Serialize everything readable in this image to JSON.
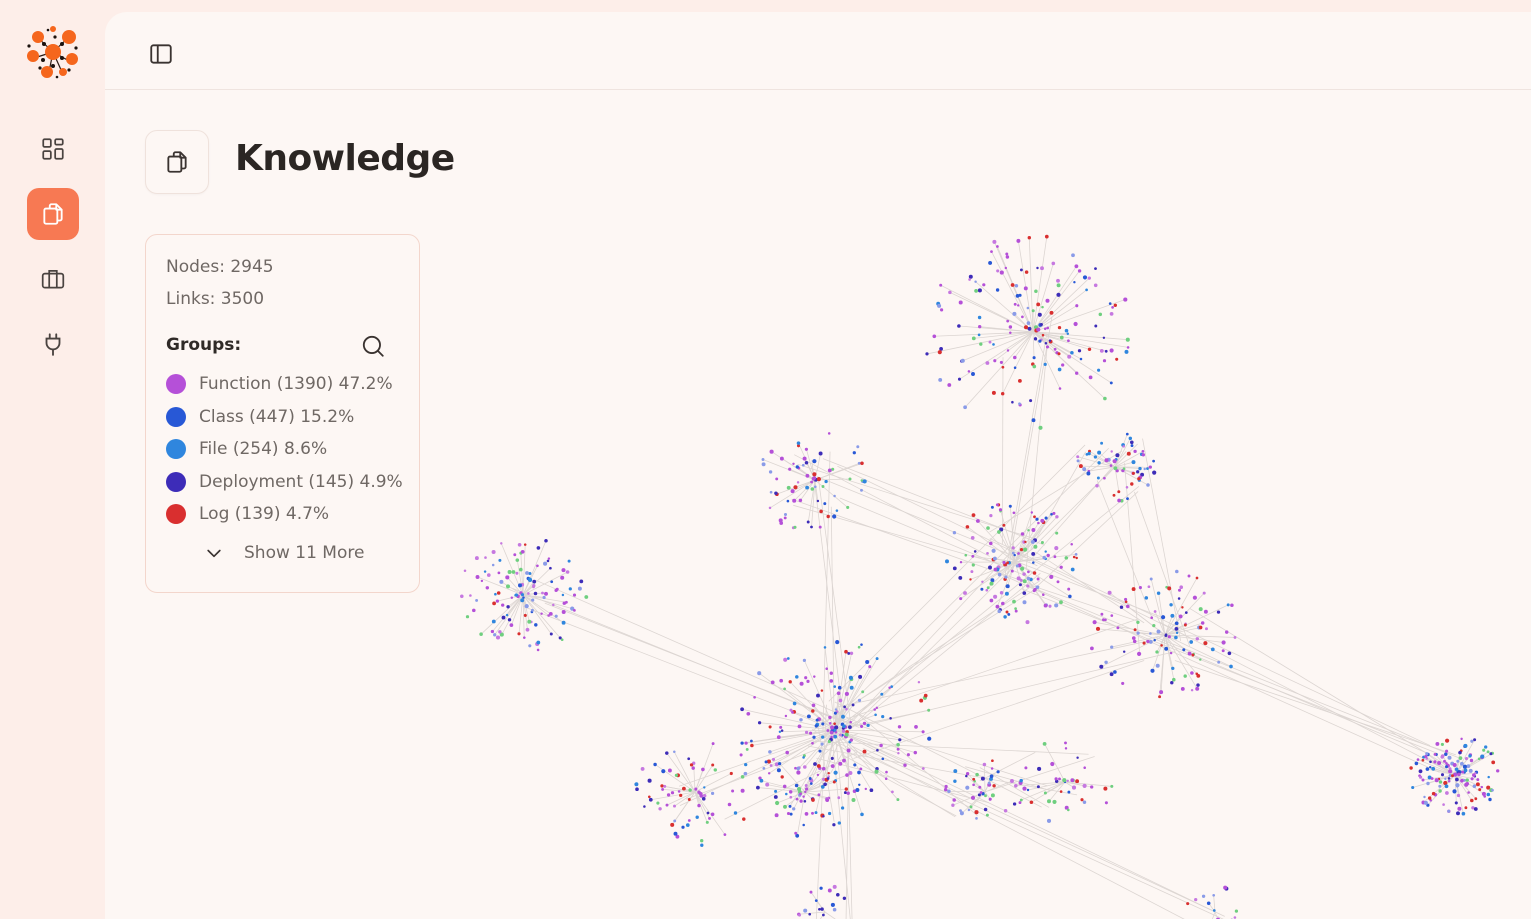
{
  "app": {
    "logo_icon": "knowledge-graph-logo",
    "accent": "#f77953"
  },
  "sidebar": {
    "items": [
      {
        "name": "dashboard",
        "icon": "grid-icon",
        "active": false
      },
      {
        "name": "knowledge",
        "icon": "documents-icon",
        "active": true
      },
      {
        "name": "briefcase",
        "icon": "briefcase-icon",
        "active": false
      },
      {
        "name": "plugins",
        "icon": "plug-icon",
        "active": false
      }
    ]
  },
  "header": {
    "toggle_icon": "sidebar-toggle-icon"
  },
  "page": {
    "title": "Knowledge",
    "title_icon": "documents-icon"
  },
  "stats": {
    "nodes_label": "Nodes: 2945",
    "links_label": "Links: 3500",
    "groups_label": "Groups:",
    "search_icon": "search-icon",
    "groups": [
      {
        "label": "Function (1390) 47.2%",
        "color": "#b550d8"
      },
      {
        "label": "Class (447) 15.2%",
        "color": "#2858d6"
      },
      {
        "label": "File (254) 8.6%",
        "color": "#2f86de"
      },
      {
        "label": "Deployment (145) 4.9%",
        "color": "#3d2cb8"
      },
      {
        "label": "Log (139) 4.7%",
        "color": "#d92f2f"
      }
    ],
    "show_more_label": "Show 11 More"
  }
}
